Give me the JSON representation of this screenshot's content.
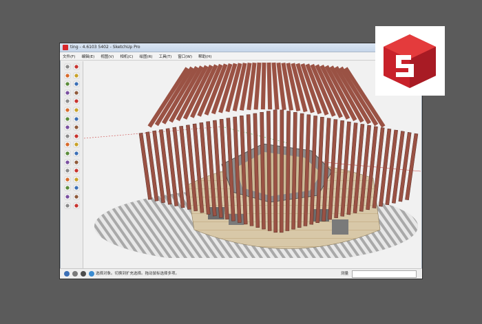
{
  "window": {
    "title": "ting - 4.6103 5402 - SketchUp Pro",
    "menus": [
      {
        "label": "文件(F)"
      },
      {
        "label": "编辑(E)"
      },
      {
        "label": "视图(V)"
      },
      {
        "label": "相机(C)"
      },
      {
        "label": "绘图(R)"
      },
      {
        "label": "工具(T)"
      },
      {
        "label": "窗口(W)"
      },
      {
        "label": "帮助(H)"
      }
    ]
  },
  "status_bar": {
    "hint": "选择对象。切换到扩充选择。拖动鼠标选择多项。",
    "measurements_label": "测量",
    "measurements_value": ""
  },
  "toolbar": {
    "tools": [
      "select-icon",
      "eraser-icon",
      "line-icon",
      "freehand-icon",
      "rectangle-icon",
      "rotated-rectangle-icon",
      "circle-icon",
      "polygon-icon",
      "arc-icon",
      "pie-icon",
      "move-icon",
      "push-pull-icon",
      "rotate-icon",
      "follow-me-icon",
      "scale-icon",
      "offset-icon",
      "tape-measure-icon",
      "dimension-icon",
      "protractor-icon",
      "text-icon",
      "axes-icon",
      "3d-text-icon",
      "paint-bucket-icon",
      "section-plane-icon",
      "orbit-icon",
      "pan-icon",
      "zoom-icon",
      "zoom-window-icon",
      "zoom-extents-icon",
      "previous-view-icon",
      "walk-icon",
      "look-around-icon",
      "footprint-icon",
      "position-camera-icon"
    ]
  },
  "colors": {
    "accent": "#d7262a",
    "slat_wood": "#9a5244",
    "desktop_bg": "#5b5b5b"
  }
}
